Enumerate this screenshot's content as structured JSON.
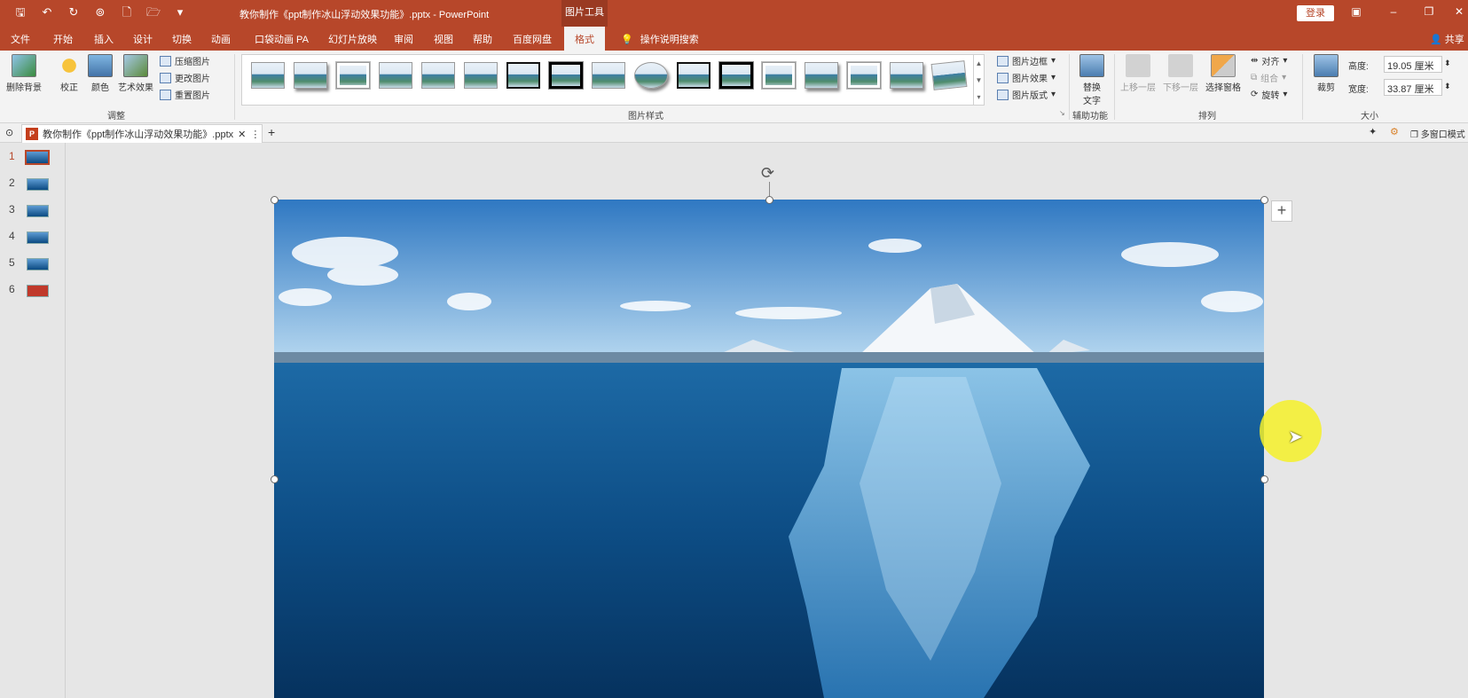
{
  "titlebar": {
    "doc_title": "教你制作《ppt制作冰山浮动效果功能》.pptx  -  PowerPoint",
    "context_tab": "图片工具",
    "login": "登录"
  },
  "menu": {
    "tabs": [
      "文件",
      "开始",
      "插入",
      "设计",
      "切换",
      "动画",
      "口袋动画 PA",
      "幻灯片放映",
      "审阅",
      "视图",
      "帮助",
      "百度网盘",
      "格式"
    ],
    "search": "操作说明搜索",
    "share": "共享"
  },
  "ribbon": {
    "adjust": {
      "remove_bg": "删除背景",
      "correct": "校正",
      "color": "颜色",
      "art_effects": "艺术效果",
      "compress": "压缩图片",
      "change": "更改图片",
      "reset": "重置图片",
      "group_label": "调整"
    },
    "styles": {
      "border": "图片边框",
      "effects": "图片效果",
      "layout": "图片版式",
      "group_label": "图片样式"
    },
    "access": {
      "alt_text_line1": "替换",
      "alt_text_line2": "文字",
      "group_label": "辅助功能"
    },
    "arrange": {
      "bring_forward": "上移一层",
      "send_backward": "下移一层",
      "selection_pane": "选择窗格",
      "align": "对齐",
      "group": "组合",
      "rotate": "旋转",
      "group_label": "排列"
    },
    "size": {
      "crop": "裁剪",
      "height_label": "高度:",
      "height_value": "19.05 厘米",
      "width_label": "宽度:",
      "width_value": "33.87 厘米",
      "group_label": "大小"
    }
  },
  "doc_tab": {
    "name": "教你制作《ppt制作冰山浮动效果功能》.pptx",
    "multi_window": "多窗口模式"
  },
  "slides": [
    "1",
    "2",
    "3",
    "4",
    "5",
    "6"
  ],
  "colors": {
    "accent": "#b7472a",
    "ribbon_bg": "#f3f3f3",
    "canvas_bg": "#e6e6e6"
  }
}
